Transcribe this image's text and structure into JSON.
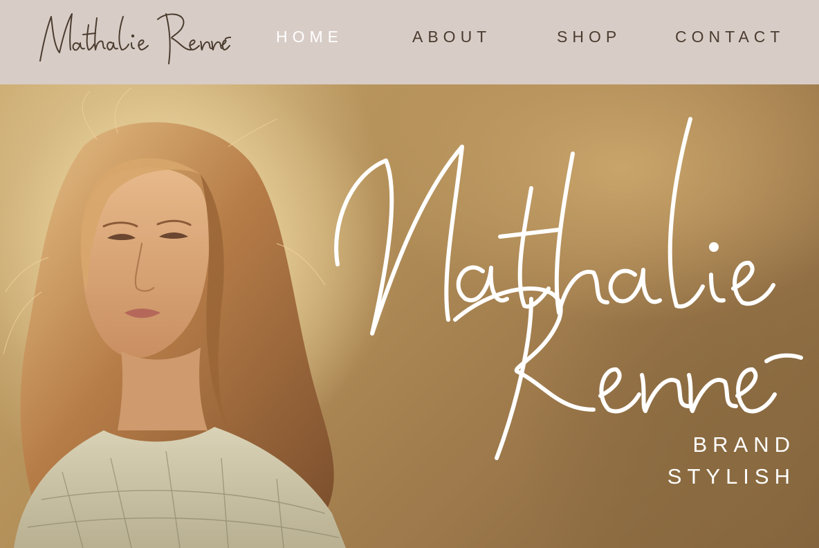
{
  "header": {
    "logo_text": "Nathalie Renner",
    "nav": [
      {
        "label": "HOME",
        "active": true
      },
      {
        "label": "ABOUT",
        "active": false
      },
      {
        "label": "SHOP",
        "active": false
      },
      {
        "label": "CONTACT",
        "active": false
      }
    ]
  },
  "hero": {
    "script_line_1": "Nathalie",
    "script_line_2": "Renner",
    "tagline_line_1": "BRAND",
    "tagline_line_2": "STYLISH",
    "photo": "portrait-photo"
  },
  "colors": {
    "nav_background": "#d8ccc6",
    "nav_text": "#4a3c2f",
    "nav_active_text": "#ffffff",
    "hero_text": "#ffffff",
    "logo_stroke": "#4a3c2f"
  }
}
